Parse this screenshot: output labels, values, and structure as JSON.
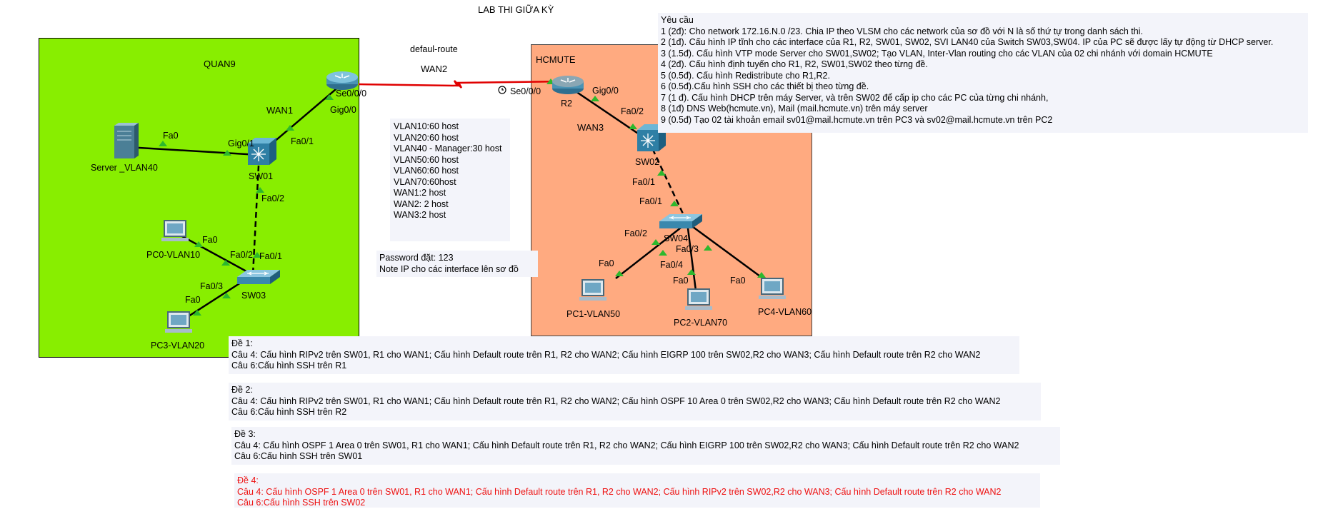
{
  "title": "LAB THI GIỮA KỲ",
  "zones": {
    "quan9": "QUAN9",
    "hcmute": "HCMUTE"
  },
  "wan": {
    "route_label": "defaul-route",
    "wan1": "WAN1",
    "wan2": "WAN2",
    "wan3": "WAN3"
  },
  "devices": {
    "server": "Server _VLAN40",
    "sw01": "SW01",
    "sw02": "SW02",
    "sw03": "SW03",
    "sw04": "SW04",
    "r2": "R2",
    "pc0": "PC0-VLAN10",
    "pc1": "PC1-VLAN50",
    "pc2": "PC2-VLAN70",
    "pc3": "PC3-VLAN20",
    "pc4": "PC4-VLAN60"
  },
  "ports": {
    "r1_se": "Se0/0/0",
    "r1_gig": "Gig0/0",
    "r2_se": "Se0/0/0",
    "r2_gig": "Gig0/0",
    "server_fa0": "Fa0",
    "sw01_gig01": "Gig0/1",
    "sw01_fa01": "Fa0/1",
    "sw01_fa02": "Fa0/2",
    "sw03_fa01": "Fa0/1",
    "sw03_fa02": "Fa0/2",
    "sw03_fa03": "Fa0/3",
    "pc0_fa0": "Fa0",
    "pc3_fa0": "Fa0",
    "sw02_fa02": "Fa0/2",
    "sw02_fa01": "Fa0/1",
    "sw04_fa01": "Fa0/1",
    "sw04_fa02": "Fa0/2",
    "sw04_fa03": "Fa0/3",
    "sw04_fa04": "Fa0/4",
    "pc1_fa0": "Fa0",
    "pc2_fa0": "Fa0",
    "pc4_fa0": "Fa0"
  },
  "vlan_notes": [
    "VLAN10:60 host",
    "VLAN20:60 host",
    "VLAN40 - Manager:30 host",
    "VLAN50:60 host",
    "VLAN60:60 host",
    "VLAN70:60host",
    "WAN1:2 host",
    "WAN2: 2 host",
    "WAN3:2 host"
  ],
  "password_notes": [
    "Password đặt: 123",
    "Note IP cho các interface lên sơ đồ"
  ],
  "requirements": [
    "Yêu cầu",
    "1 (2đ): Cho network 172.16.N.0 /23. Chia IP theo VLSM cho các network của sơ đồ với N là số thứ tự trong danh sách thi.",
    "2 (1đ). Cấu hình IP tĩnh cho các interface của R1, R2, SW01, SW02, SVI LAN40 của Switch SW03,SW04. IP của PC sẽ được lấy tự động từ DHCP server.",
    "3 (1.5đ). Cấu hình VTP mode Server cho SW01,SW02; Tạo VLAN,  Inter-Vlan routing cho các VLAN của 02 chi nhánh với domain HCMUTE",
    "4 (2đ). Cấu hình định tuyến cho R1, R2, SW01,SW02 theo từng đề.",
    "5 (0.5đ). Cấu hình Redistribute cho R1,R2.",
    "6 (0.5đ).Cấu hình SSH cho các thiết bị theo từng đề.",
    "7 (1 đ). Cấu hình DHCP trên máy Server, và  trên SW02 để cấp ip cho các PC của từng chi nhánh,",
    "8 (1đ) DNS Web(hcmute.vn), Mail (mail.hcmute.vn) trên máy server",
    "9 (0.5đ) Tạo 02 tài khoản email sv01@mail.hcmute.vn trên PC3 và sv02@mail.hcmute.vn trên PC2"
  ],
  "exams": [
    {
      "title": "Đề 1:",
      "q4": "Câu 4: Cấu hình RIPv2 trên SW01, R1 cho WAN1; Cấu hình Default route trên R1, R2 cho WAN2; Cấu hình EIGRP 100 trên SW02,R2 cho WAN3; Cấu hình Default route trên R2 cho WAN2",
      "q6": "Câu 6:Cấu hình SSH trên R1"
    },
    {
      "title": "Đề 2:",
      "q4": "Câu 4: Cấu hình RIPv2 trên SW01, R1 cho WAN1; Cấu hình Default route trên R1, R2 cho WAN2; Cấu hình OSPF 10 Area 0 trên SW02,R2 cho WAN3; Cấu hình Default route trên R2 cho WAN2",
      "q6": "Câu 6:Cấu hình SSH trên R2"
    },
    {
      "title": "Đề 3:",
      "q4": "Câu 4: Cấu hình OSPF 1 Area 0 trên SW01, R1 cho WAN1; Cấu hình Default route trên R1, R2 cho WAN2; Cấu hình EIGRP 100 trên SW02,R2 cho WAN3; Cấu hình Default route trên R2 cho WAN2",
      "q6": "Câu 6:Cấu hình SSH trên SW01"
    },
    {
      "title": "Đề 4:",
      "q4": "Câu 4: Cấu hình OSPF 1 Area 0 trên SW01, R1 cho WAN1; Cấu hình Default route trên R1, R2 cho WAN2; Cấu hình RIPv2 trên SW02,R2 cho WAN3; Cấu hình Default route trên R2 cho WAN2",
      "q6": "Câu 6:Cấu hình SSH trên SW02"
    }
  ],
  "colors": {
    "quan9": "#88ee00",
    "hcmute": "#ffaa80",
    "serial_link": "#e00000",
    "highlight_exam": "#ee1111"
  }
}
